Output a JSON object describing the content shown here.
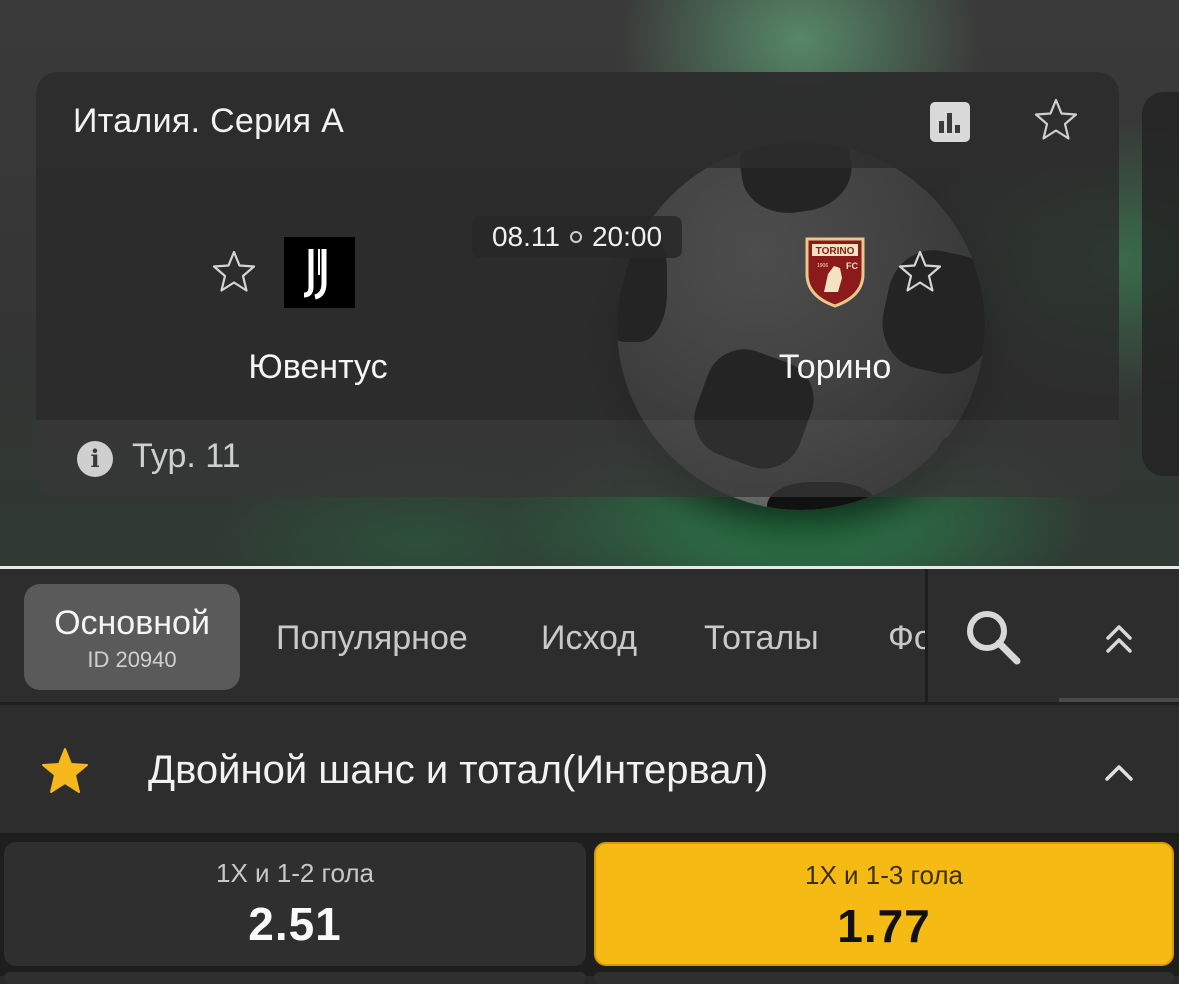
{
  "event": {
    "league": "Италия. Серия А",
    "date": "08.11",
    "time": "20:00",
    "home_team": "Ювентус",
    "away_team": "Торино",
    "round": "Тур. 11",
    "torino_badge_text": "TORINO",
    "torino_badge_year": "1906",
    "torino_badge_fc": "FC"
  },
  "icons": {
    "stats": "bar-chart-icon",
    "favorite": "star-outline-icon",
    "info": "info-icon",
    "search": "search-icon",
    "collapse": "double-chevron-up-icon",
    "market_favorite": "star-filled-icon",
    "market_toggle": "chevron-up-icon"
  },
  "tabs": {
    "active_label": "Основной",
    "active_sub": "ID 20940",
    "items": [
      "Популярное",
      "Исход",
      "Тоталы",
      "Форы"
    ]
  },
  "market": {
    "title": "Двойной шанс и тотал(Интервал)",
    "odds": [
      {
        "label": "1X и 1-2 гола",
        "value": "2.51",
        "selected": false
      },
      {
        "label": "1X и 1-3 гола",
        "value": "1.77",
        "selected": true
      }
    ]
  },
  "colors": {
    "accent": "#f5bb14",
    "background": "#2b2b2b",
    "favorite_star": "#f6b81a"
  }
}
